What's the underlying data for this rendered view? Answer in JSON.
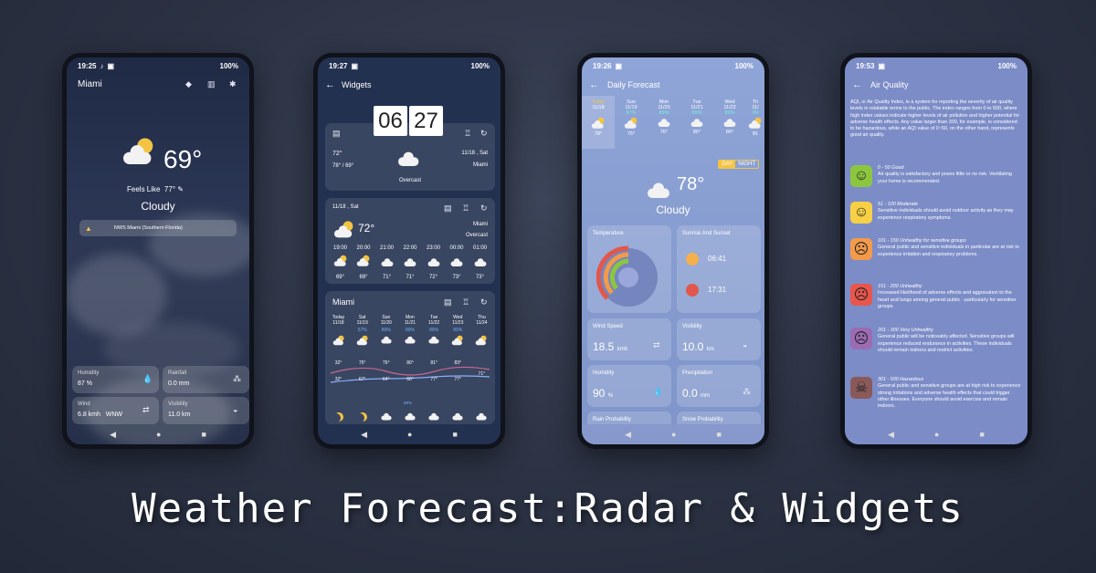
{
  "headline": "Weather Forecast:Radar & Widgets",
  "phone1": {
    "time": "19:25",
    "battery": "100%",
    "city": "Miami",
    "temp": "69°",
    "feels_label": "Feels Like",
    "feels": "77°",
    "condition": "Cloudy",
    "alert": "NWS Miami (Southern Florida)",
    "cards": [
      {
        "label": "Humidity",
        "value": "87 %"
      },
      {
        "label": "Rainfall",
        "value": "0.0 mm"
      },
      {
        "label": "Wind",
        "value": "6.8 kmh",
        "extra": "WNW"
      },
      {
        "label": "Visibility",
        "value": "11.0 km"
      }
    ]
  },
  "phone2": {
    "time": "19:27",
    "battery": "100%",
    "title": "Widgets",
    "clock_h": "06",
    "clock_m": "27",
    "w1": {
      "temp": "72°",
      "range": "78° / 69°",
      "cond": "Overcast",
      "date": "11/18 , Sat",
      "city": "Miami"
    },
    "w2": {
      "date": "11/18 , Sat",
      "temp": "72°",
      "city": "Miami",
      "cond": "Overcast",
      "hours": [
        "19:00",
        "20:00",
        "21:00",
        "22:00",
        "23:00",
        "00:00",
        "01:00"
      ],
      "temps": [
        "69°",
        "69°",
        "71°",
        "71°",
        "72°",
        "73°",
        "73°"
      ]
    },
    "w3": {
      "city": "Miami",
      "days": [
        "Today",
        "Sat",
        "Sun",
        "Mon",
        "Tue",
        "Wed",
        "Thu"
      ],
      "dates": [
        "11/18",
        "11/19",
        "11/20",
        "11/21",
        "11/22",
        "11/23",
        "11/24"
      ],
      "pops": [
        "",
        "57%",
        "89%",
        "89%",
        "89%",
        "89%",
        ""
      ],
      "highs": [
        "",
        "75°",
        "76°",
        "80°",
        "81°",
        "83°",
        ""
      ],
      "lows": [
        "",
        "67°",
        "64°",
        "60°",
        "77°",
        "77°",
        "71°"
      ],
      "low_left": "32°",
      "high_left": "32°",
      "pop_bottom": "89%"
    }
  },
  "phone3": {
    "time": "19:26",
    "battery": "100%",
    "title": "Daily Forecast",
    "days": [
      "Today",
      "Sun",
      "Mon",
      "Tue",
      "Wed",
      "Th"
    ],
    "dates": [
      "11/18",
      "11/19",
      "11/20",
      "11/21",
      "11/22",
      "11/"
    ],
    "pops": [
      "",
      "87%",
      "89%",
      "89%",
      "89%",
      "89"
    ],
    "temps": [
      "78°",
      "75°",
      "76°",
      "80°",
      "80°",
      "81"
    ],
    "day_label": "DAY",
    "night_label": "NIGHT",
    "temp": "78°",
    "condition": "Cloudy",
    "temperature_card": "Temperature",
    "sun_card": "Sunrise And Sunset",
    "sunrise": "06:41",
    "sunset": "17:31",
    "wind_label": "Wind Speed",
    "wind_value": "18.5",
    "wind_unit": "kmh",
    "vis_label": "Visibility",
    "vis_value": "10.0",
    "vis_unit": "km",
    "hum_label": "Humidity",
    "hum_value": "90",
    "hum_unit": "%",
    "prec_label": "Precipitation",
    "prec_value": "0.0",
    "prec_unit": "mm",
    "rain_label": "Rain Probability",
    "snow_label": "Snow Probability"
  },
  "phone4": {
    "time": "19:53",
    "battery": "100%",
    "title": "Air Quality",
    "intro": "AQI, or Air Quality Index, is a system for reporting the severity of air quality levels in relatable terms to the public. The index ranges from 0 to 500, where high index values indicate higher levels of air pollution and higher potential for adverse health effects. Any value larger than 300, for example, is considered to be hazardous, while an AQI value of 0~50, on the other hand, represents good air quality.",
    "levels": [
      {
        "title": "0 - 50 Good",
        "desc": "Air quality is satisfactory and poses little or no risk. Ventilating your home is recommended.",
        "color": "#8cc63f",
        "face": "☺"
      },
      {
        "title": "51 - 100 Moderate",
        "desc": "Sensitive individuals should avoid outdoor activity as they may experience respiratory symptoms.",
        "color": "#f7d046",
        "face": "☺"
      },
      {
        "title": "101 - 150 Unhealthy for sensitive groups",
        "desc": "General public and sensitive individuals in particular are at risk to experience irritation and respiratory problems.",
        "color": "#f29a4a",
        "face": "☹"
      },
      {
        "title": "151 - 200 Unhealthy",
        "desc": "Increased likelihood of adverse effects and aggravation to the heart and lungs among general public - particularly for sensitive groups.",
        "color": "#e8564b",
        "face": "☹"
      },
      {
        "title": "201 - 300 Very Unhealthy",
        "desc": "General public will be noticeably affected. Sensitive groups will experience reduced endurance in activities. These individuals should remain indoors and restrict activities.",
        "color": "#9b6bb3",
        "face": "☹"
      },
      {
        "title": "301 - 500 Hazardous",
        "desc": "General public and sensitive groups are at high risk to experience strong irritations and adverse health effects that could trigger other illnesses. Everyone should avoid exercise and remain indoors.",
        "color": "#8a5a5a",
        "face": "☠"
      }
    ]
  }
}
